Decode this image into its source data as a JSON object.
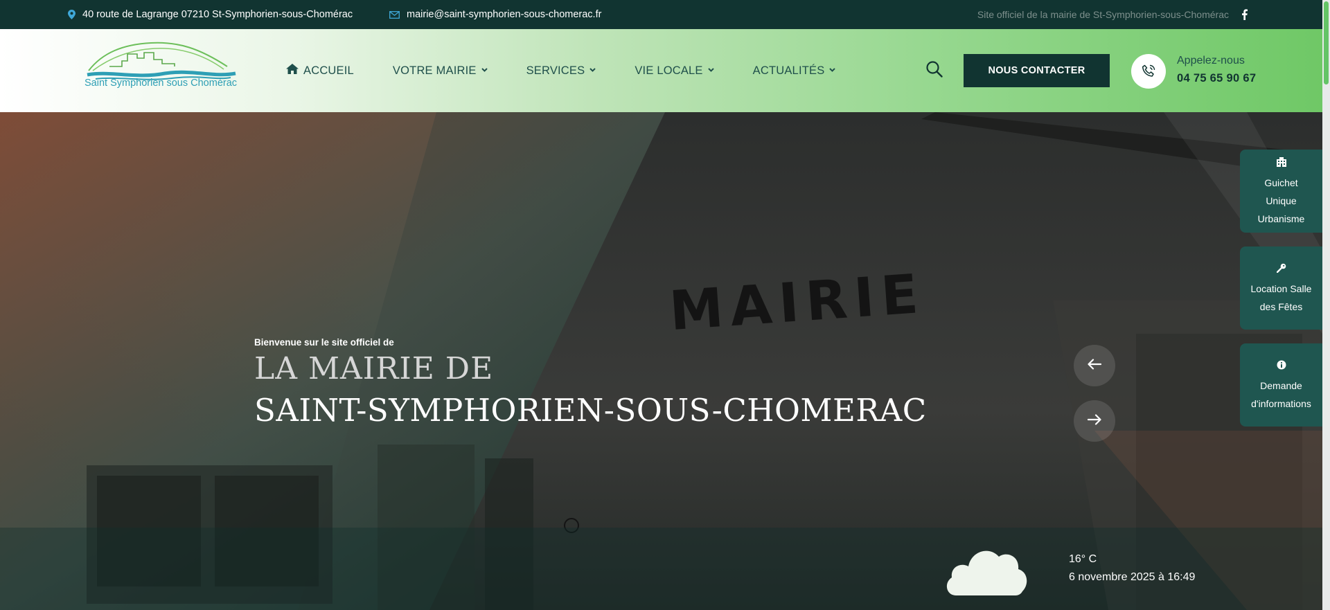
{
  "topbar": {
    "address": "40 route de Lagrange 07210 St-Symphorien-sous-Chomérac",
    "email": "mairie@saint-symphorien-sous-chomerac.fr",
    "tagline": "Site officiel de la mairie de St-Symphorien-sous-Chomérac",
    "icons": [
      "map-pin-icon",
      "envelope-icon",
      "facebook-icon"
    ]
  },
  "header": {
    "logo_text": "Saint Symphorien sous Chomérac",
    "nav": [
      {
        "label": "ACCUEIL",
        "icon": "home-icon"
      },
      {
        "label": "VOTRE MAIRIE",
        "icon": "chevron-down-icon"
      },
      {
        "label": "SERVICES",
        "icon": "chevron-down-icon"
      },
      {
        "label": "VIE LOCALE",
        "icon": "chevron-down-icon"
      },
      {
        "label": "ACTUALITÉS",
        "icon": "chevron-down-icon"
      }
    ],
    "contact_button": "NOUS CONTACTER",
    "phone_label": "Appelez-nous",
    "phone_number": "04 75 65 90 67"
  },
  "hero": {
    "welcome": "Bienvenue sur le site officiel de",
    "title_line1": "LA MAIRIE DE",
    "title_line2": "SAINT-SYMPHORIEN-SOUS-CHOMERAC",
    "building_sign": "MAIRIE",
    "weather": {
      "icon": "cloud-icon",
      "temperature": "16° C",
      "datetime": "6 novembre 2025 à 16:49"
    }
  },
  "side_tabs": [
    {
      "lines": [
        "Guichet",
        "Unique",
        "Urbanisme"
      ],
      "icon": "building-icon"
    },
    {
      "lines": [
        "Location Salle",
        "des Fêtes"
      ],
      "icon": "key-icon"
    },
    {
      "lines": [
        "Demande",
        "d'informations"
      ],
      "icon": "info-icon"
    }
  ],
  "colors": {
    "dark_teal": "#113431",
    "green": "#6fc866",
    "side_tab": "#1f5650"
  }
}
